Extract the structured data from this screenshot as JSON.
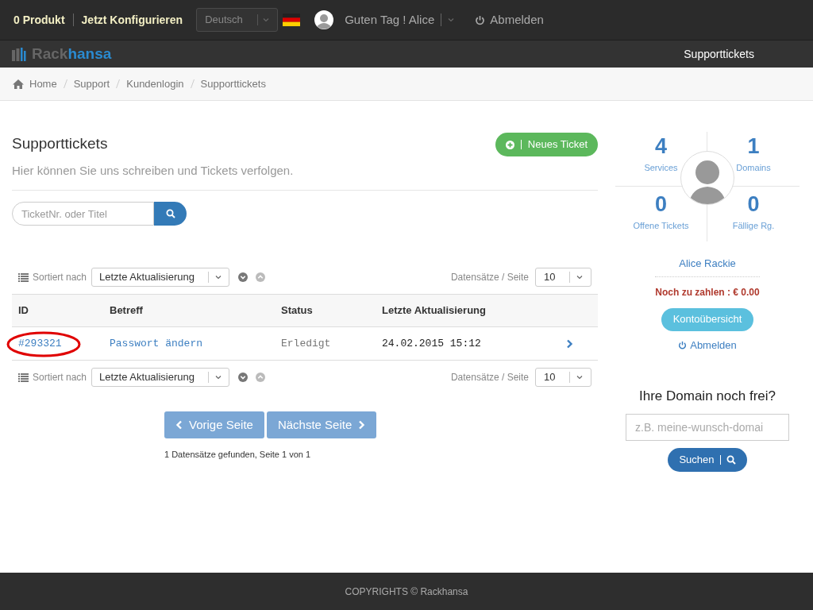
{
  "topbar": {
    "cart": "0 Produkt",
    "configure": "Jetzt Konfigurieren",
    "language": "Deutsch",
    "greeting": "Guten Tag ! Alice",
    "logout": "Abmelden"
  },
  "navbar": {
    "logo_part_1": "Rack",
    "logo_part_2": "hansa",
    "items": [
      {
        "label": "Supporttickets",
        "selected": true
      }
    ]
  },
  "breadcrumb": [
    "Home",
    "Support",
    "Kundenlogin",
    "Supporttickets"
  ],
  "page": {
    "title": "Supporttickets",
    "subtitle": "Hier können Sie uns schreiben und Tickets verfolgen.",
    "new_ticket": "Neues Ticket",
    "search": {
      "placeholder": "TicketNr. oder Titel"
    }
  },
  "toolbars": [
    {
      "sort_label": "Sortiert nach",
      "sort_value": "Letzte Aktualisierung",
      "per_page_label": "Datensätze / Seite",
      "per_page_value": "10"
    },
    {
      "sort_label": "Sortiert nach",
      "sort_value": "Letzte Aktualisierung",
      "per_page_label": "Datensätze / Seite",
      "per_page_value": "10"
    }
  ],
  "table": {
    "columns": [
      "ID",
      "Betreff",
      "Status",
      "Letzte Aktualisierung"
    ],
    "rows": [
      {
        "id": "#293321",
        "subject": "Passwort ändern",
        "status": "Erledigt",
        "updated": "24.02.2015 15:12",
        "circled": true
      }
    ]
  },
  "pagination": {
    "buttons": [
      {
        "kind": "prev",
        "label": "Vorige Seite",
        "disabled": true
      },
      {
        "kind": "next",
        "label": "Nächste Seite",
        "disabled": true
      }
    ],
    "summary": "1 Datensätze gefunden, Seite 1 von 1"
  },
  "sidebar": {
    "stats": [
      {
        "value": "4",
        "label": "Services"
      },
      {
        "value": "1",
        "label": "Domains"
      },
      {
        "value": "0",
        "label": "Offene Tickets"
      },
      {
        "value": "0",
        "label": "Fällige Rg."
      }
    ],
    "name": "Alice Rackie",
    "balance": "Noch zu zahlen : € 0.00",
    "account_button": "Kontoübersicht",
    "logout": "Abmelden",
    "domain_title": "Ihre Domain noch frei?",
    "domain_field": {
      "placeholder": "z.B. meine-wunsch-domai"
    },
    "domain_button": "Suchen"
  },
  "footer": "COPYRIGHTS © Rackhansa"
}
